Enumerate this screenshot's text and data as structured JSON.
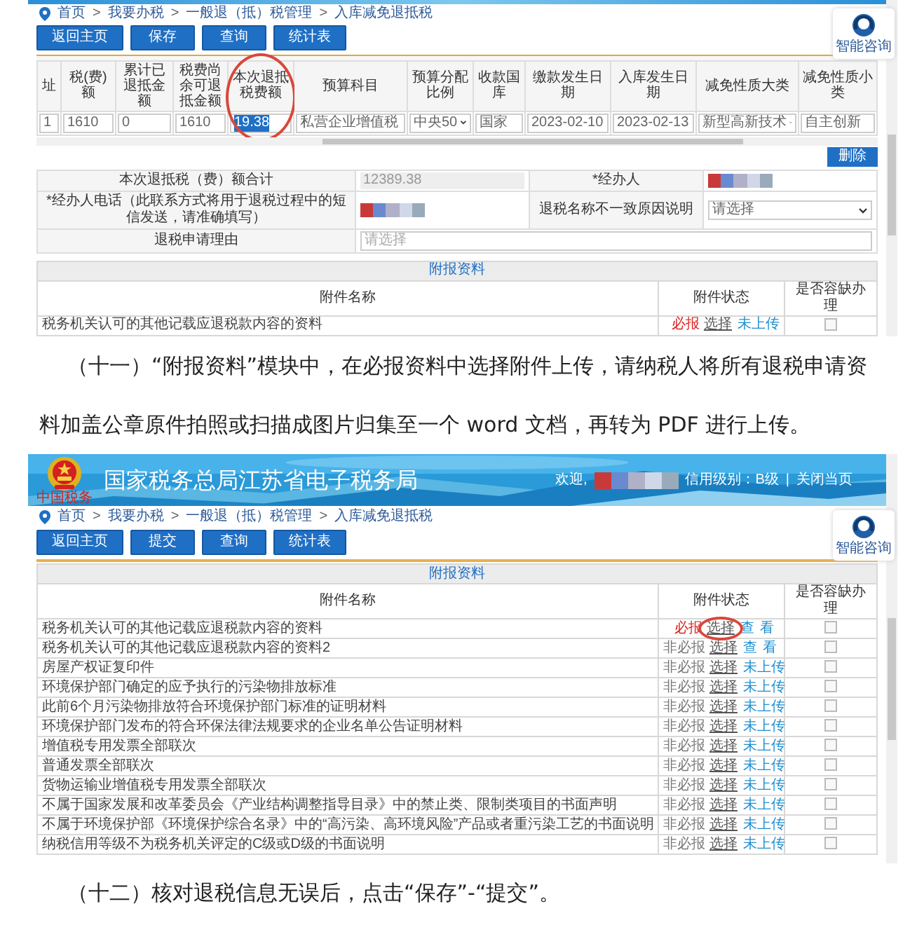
{
  "screenshot_1": {
    "breadcrumb": [
      {
        "kind": "link",
        "text": "首页"
      },
      {
        "kind": "separator",
        "text": ">"
      },
      {
        "kind": "link",
        "text": "我要办税"
      },
      {
        "kind": "separator",
        "text": ">"
      },
      {
        "kind": "link",
        "text": "一般退（抵）税管理"
      },
      {
        "kind": "separator",
        "text": ">"
      },
      {
        "kind": "link",
        "text": "入库减免退抵税"
      }
    ],
    "toolbar": [
      "返回主页",
      "保存",
      "查询",
      "统计表"
    ],
    "assistant": "智能咨询",
    "refund_table": {
      "columns": [
        {
          "label": "址",
          "circled": false
        },
        {
          "label": "税(费)额",
          "circled": false
        },
        {
          "label": "累计已退抵金额",
          "circled": false
        },
        {
          "label": "税费尚余可退抵金额",
          "circled": false
        },
        {
          "label": "本次退抵税费额",
          "circled": true
        },
        {
          "label": "预算科目",
          "circled": false
        },
        {
          "label": "预算分配比例",
          "circled": false
        },
        {
          "label": "收款国库",
          "circled": false
        },
        {
          "label": "缴款发生日期",
          "circled": false
        },
        {
          "label": "入库发生日期",
          "circled": false
        },
        {
          "label": "减免性质大类",
          "circled": false
        },
        {
          "label": "减免性质小类",
          "circled": false
        }
      ],
      "row": [
        {
          "kind": "input",
          "value": "1",
          "text_selected": false
        },
        {
          "kind": "input",
          "value": "1610",
          "text_selected": false
        },
        {
          "kind": "input",
          "value": "0",
          "text_selected": false
        },
        {
          "kind": "input",
          "value": "1610",
          "text_selected": false
        },
        {
          "kind": "input",
          "value": "19.38",
          "text_selected": true
        },
        {
          "kind": "select",
          "value": "私营企业增值税",
          "text_selected": false
        },
        {
          "kind": "select",
          "value": "中央50",
          "text_selected": false
        },
        {
          "kind": "input",
          "value": "国家",
          "text_selected": false
        },
        {
          "kind": "input",
          "value": "2023-02-10",
          "text_selected": false
        },
        {
          "kind": "input",
          "value": "2023-02-13",
          "text_selected": false
        },
        {
          "kind": "select",
          "value": "新型高新技术",
          "text_selected": false
        },
        {
          "kind": "input",
          "value": "自主创新",
          "text_selected": false
        }
      ]
    },
    "delete_button": "删除",
    "summary_form": [
      [
        {
          "kind": "label",
          "text": "本次退抵税（费）额合计"
        },
        {
          "kind": "readonly",
          "text": "12389.38"
        },
        {
          "kind": "label",
          "text": "*经办人"
        },
        {
          "kind": "blurred"
        }
      ],
      [
        {
          "kind": "label",
          "text": "*经办人电话（此联系方式将用于退税过程中的短信发送，请准确填写）"
        },
        {
          "kind": "blurred"
        },
        {
          "kind": "label",
          "text": "退税名称不一致原因说明"
        },
        {
          "kind": "select",
          "text": "请选择"
        }
      ],
      [
        {
          "kind": "label",
          "text": "退税申请理由"
        },
        {
          "kind": "placeholder",
          "text": "请选择"
        }
      ]
    ],
    "attachments": {
      "title": "附报资料",
      "columns": [
        "附件名称",
        "附件状态",
        "是否容缺办理"
      ],
      "rows": [
        {
          "name": "税务机关认可的其他记载应退税款内容的资料",
          "requirement": "必报",
          "required": true,
          "action": "选择",
          "status": "未上传",
          "uploaded": false,
          "circled": false,
          "checked": false
        }
      ]
    }
  },
  "paragraph_1": "（十一）“附报资料”模块中，在必报资料中选择附件上传，请纳税人将所有退税申请资料加盖公章原件拍照或扫描成图片归集至一个 word 文档，再转为 PDF 进行上传。",
  "screenshot_2": {
    "header": {
      "title": "国家税务总局江苏省电子税务局",
      "seal_text": "中国税务",
      "welcome": "欢迎,",
      "credit": "信用级别：B级",
      "separator": "|",
      "close": "关闭当页"
    },
    "breadcrumb": [
      {
        "kind": "link",
        "text": "首页"
      },
      {
        "kind": "separator",
        "text": ">"
      },
      {
        "kind": "link",
        "text": "我要办税"
      },
      {
        "kind": "separator",
        "text": ">"
      },
      {
        "kind": "link",
        "text": "一般退（抵）税管理"
      },
      {
        "kind": "separator",
        "text": ">"
      },
      {
        "kind": "link",
        "text": "入库减免退抵税"
      }
    ],
    "toolbar": [
      "返回主页",
      "提交",
      "查询",
      "统计表"
    ],
    "assistant": "智能咨询",
    "attachments": {
      "title": "附报资料",
      "columns": [
        "附件名称",
        "附件状态",
        "是否容缺办理"
      ],
      "rows": [
        {
          "name": "税务机关认可的其他记载应退税款内容的资料",
          "requirement": "必报",
          "required": true,
          "action": "选择",
          "status": "查看",
          "uploaded": true,
          "circled": true,
          "checked": false
        },
        {
          "name": "税务机关认可的其他记载应退税款内容的资料2",
          "requirement": "非必报",
          "required": false,
          "action": "选择",
          "status": "查看",
          "uploaded": true,
          "circled": false,
          "checked": false
        },
        {
          "name": "房屋产权证复印件",
          "requirement": "非必报",
          "required": false,
          "action": "选择",
          "status": "未上传",
          "uploaded": false,
          "circled": false,
          "checked": false
        },
        {
          "name": "环境保护部门确定的应予执行的污染物排放标准",
          "requirement": "非必报",
          "required": false,
          "action": "选择",
          "status": "未上传",
          "uploaded": false,
          "circled": false,
          "checked": false
        },
        {
          "name": "此前6个月污染物排放符合环境保护部门标准的证明材料",
          "requirement": "非必报",
          "required": false,
          "action": "选择",
          "status": "未上传",
          "uploaded": false,
          "circled": false,
          "checked": false
        },
        {
          "name": "环境保护部门发布的符合环保法律法规要求的企业名单公告证明材料",
          "requirement": "非必报",
          "required": false,
          "action": "选择",
          "status": "未上传",
          "uploaded": false,
          "circled": false,
          "checked": false
        },
        {
          "name": "增值税专用发票全部联次",
          "requirement": "非必报",
          "required": false,
          "action": "选择",
          "status": "未上传",
          "uploaded": false,
          "circled": false,
          "checked": false
        },
        {
          "name": "普通发票全部联次",
          "requirement": "非必报",
          "required": false,
          "action": "选择",
          "status": "未上传",
          "uploaded": false,
          "circled": false,
          "checked": false
        },
        {
          "name": "货物运输业增值税专用发票全部联次",
          "requirement": "非必报",
          "required": false,
          "action": "选择",
          "status": "未上传",
          "uploaded": false,
          "circled": false,
          "checked": false
        },
        {
          "name": "不属于国家发展和改革委员会《产业结构调整指导目录》中的禁止类、限制类项目的书面声明",
          "requirement": "非必报",
          "required": false,
          "action": "选择",
          "status": "未上传",
          "uploaded": false,
          "circled": false,
          "checked": false
        },
        {
          "name": "不属于环境保护部《环境保护综合名录》中的“高污染、高环境风险”产品或者重污染工艺的书面说明",
          "requirement": "非必报",
          "required": false,
          "action": "选择",
          "status": "未上传",
          "uploaded": false,
          "circled": false,
          "checked": false
        },
        {
          "name": "纳税信用等级不为税务机关评定的C级或D级的书面说明",
          "requirement": "非必报",
          "required": false,
          "action": "选择",
          "status": "未上传",
          "uploaded": false,
          "circled": false,
          "checked": false
        }
      ]
    }
  },
  "paragraph_2": "（十二）核对退税信息无误后，点击“保存”-“提交”。"
}
